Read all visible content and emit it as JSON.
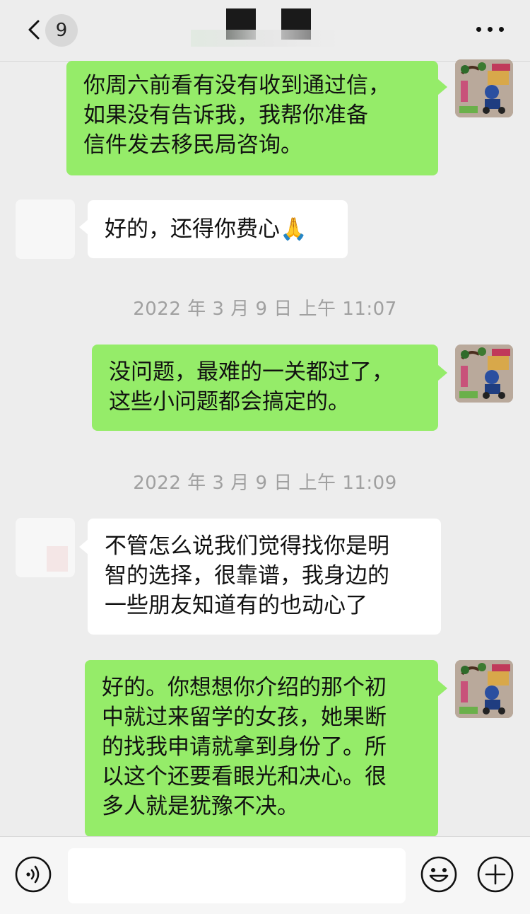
{
  "header": {
    "unread_count": "9",
    "back_icon": "chevron-left-icon",
    "more_icon": "more-dots-icon"
  },
  "messages": [
    {
      "from": "self",
      "text": "你周六前看有没有收到通过信，\n如果没有告诉我，我帮你准备\n信件发去移民局咨询。"
    },
    {
      "from": "other",
      "text": "好的，还得你费心🙏"
    },
    {
      "from": "system",
      "text": "2022 年 3 月 9 日 上午 11:07"
    },
    {
      "from": "self",
      "text": "没问题，最难的一关都过了，\n这些小问题都会搞定的。"
    },
    {
      "from": "system",
      "text": "2022 年 3 月 9 日 上午 11:09"
    },
    {
      "from": "other",
      "text": "不管怎么说我们觉得找你是明\n智的选择，很靠谱，我身边的\n一些朋友知道有的也动心了"
    },
    {
      "from": "self",
      "text": "好的。你想想你介绍的那个初\n中就过来留学的女孩，她果断\n的找我申请就拿到身份了。所\n以这个还要看眼光和决心。很\n多人就是犹豫不决。"
    }
  ],
  "input_bar": {
    "placeholder": "",
    "voice_icon": "voice-icon",
    "emoji_icon": "emoji-icon",
    "plus_icon": "plus-icon"
  },
  "colors": {
    "background": "#ededed",
    "self_bubble": "#95ec69",
    "other_bubble": "#ffffff",
    "timestamp": "#a0a0a0"
  }
}
